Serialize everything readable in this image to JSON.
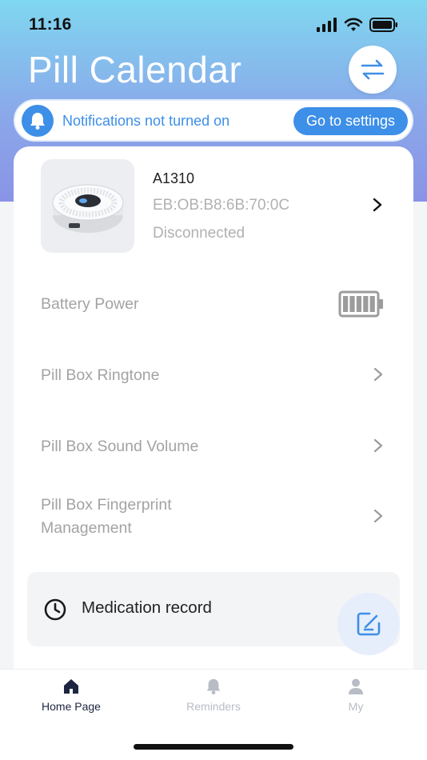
{
  "status_bar": {
    "time": "11:16"
  },
  "header": {
    "title": "Pill Calendar",
    "switch_icon": "swap-arrows-icon"
  },
  "notification": {
    "message": "Notifications not turned on",
    "action_label": "Go to settings",
    "icon": "bell-icon"
  },
  "device": {
    "name": "A1310",
    "mac": "EB:OB:B8:6B:70:0C",
    "status": "Disconnected"
  },
  "settings": {
    "battery_label": "Battery Power",
    "battery_level": 1.0,
    "ringtone_label": "Pill Box Ringtone",
    "volume_label": "Pill Box Sound Volume",
    "fingerprint_label": "Pill Box Fingerprint Management"
  },
  "medication": {
    "label": "Medication record"
  },
  "tabs": [
    {
      "label": "Home Page",
      "icon": "home-icon",
      "active": true
    },
    {
      "label": "Reminders",
      "icon": "bell-icon",
      "active": false
    },
    {
      "label": "My",
      "icon": "user-icon",
      "active": false
    }
  ],
  "colors": {
    "accent": "#3d8fe8",
    "active_tab": "#1e2540",
    "inactive_tab": "#b8bcc4",
    "muted_text": "#a3a3a3"
  }
}
